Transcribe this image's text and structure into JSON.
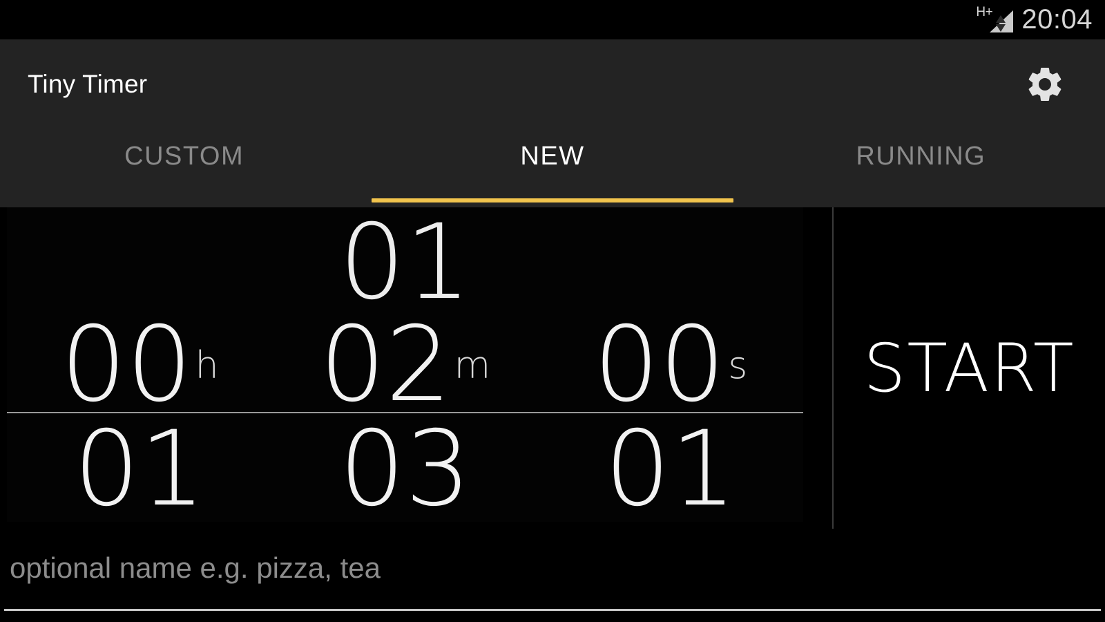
{
  "status_bar": {
    "network_type": "H+",
    "signal_icon": "signal-triangle-icon",
    "clock": "20:04"
  },
  "action_bar": {
    "app_title": "Tiny Timer",
    "settings_icon": "gear-icon"
  },
  "tabs": [
    {
      "label": "CUSTOM",
      "active": false
    },
    {
      "label": "NEW",
      "active": true
    },
    {
      "label": "RUNNING",
      "active": false
    }
  ],
  "time_picker": {
    "columns": [
      {
        "unit": "h",
        "unit_name": "hours",
        "above": "",
        "value": "00",
        "below": "01"
      },
      {
        "unit": "m",
        "unit_name": "minutes",
        "above": "01",
        "value": "02",
        "below": "03"
      },
      {
        "unit": "s",
        "unit_name": "seconds",
        "above": "",
        "value": "00",
        "below": "01"
      }
    ]
  },
  "start_button": {
    "label": "START"
  },
  "name_field": {
    "value": "",
    "placeholder": "optional name e.g. pizza, tea"
  },
  "colors": {
    "background": "#000000",
    "bar_background": "#232323",
    "accent": "#f2c44d",
    "text_primary": "#ffffff",
    "text_secondary": "#8a8a8a",
    "divider": "#9a9a9a"
  }
}
